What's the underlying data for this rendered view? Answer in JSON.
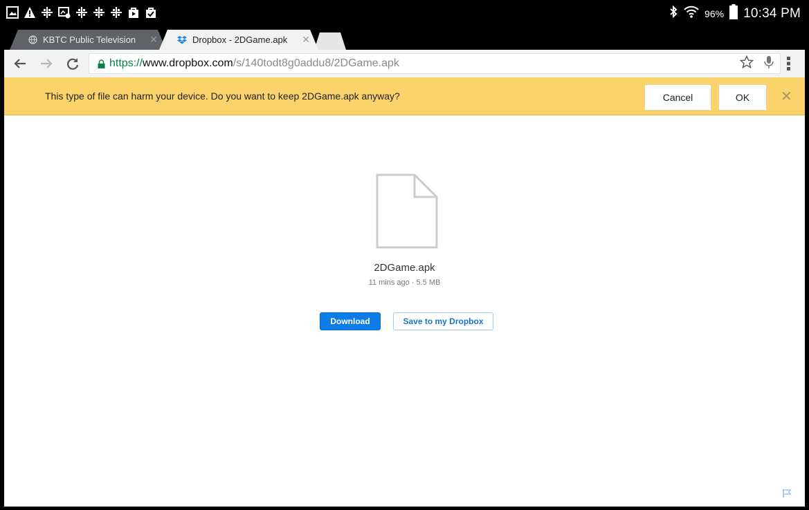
{
  "status_bar": {
    "battery_percent": "96%",
    "time": "10:34 PM",
    "icons": [
      "gallery-icon",
      "warning-icon",
      "data-sync-icon",
      "screen-capture-icon",
      "data-sync-icon",
      "data-sync-icon",
      "data-sync-icon",
      "play-store-icon",
      "checklist-icon",
      "bluetooth-icon",
      "wifi-icon",
      "battery-icon"
    ]
  },
  "tabs": [
    {
      "title": "KBTC Public Television",
      "active": false,
      "favicon": "globe-icon"
    },
    {
      "title": "Dropbox - 2DGame.apk",
      "active": true,
      "favicon": "dropbox-icon"
    }
  ],
  "toolbar": {
    "url_scheme": "https://",
    "url_host": "www.dropbox.com",
    "url_path": "/s/140todt8g0addu8/2DGame.apk"
  },
  "infobar": {
    "message": "This type of file can harm your device. Do you want to keep 2DGame.apk anyway?",
    "cancel_label": "Cancel",
    "ok_label": "OK"
  },
  "file": {
    "name": "2DGame.apk",
    "meta": "11 mins ago · 5.5 MB",
    "download_label": "Download",
    "save_label": "Save to my Dropbox"
  },
  "colors": {
    "infobar_bg": "#fad46b",
    "primary_button": "#0d7ce6",
    "url_secure": "#0b8043"
  }
}
